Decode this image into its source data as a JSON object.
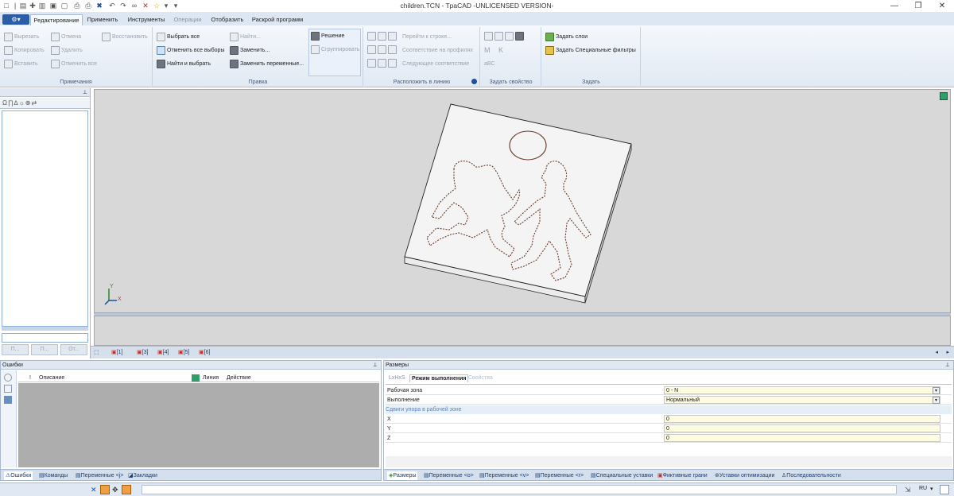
{
  "app": {
    "window_title": "children.TCN - TpaCAD -UNLICENSED VERSION-"
  },
  "window_controls": [
    "minimize-icon",
    "restore-icon",
    "close-icon"
  ],
  "menu_tabs": [
    {
      "label": "Редактирование",
      "active": true
    },
    {
      "label": "Применить",
      "active": false
    },
    {
      "label": "Инструменты",
      "active": false
    },
    {
      "label": "Операции",
      "active": false
    },
    {
      "label": "Отобразить",
      "active": false
    },
    {
      "label": "Раскрой программ",
      "active": false
    }
  ],
  "ribbon": {
    "notes": {
      "label": "Примечания",
      "items": [
        "Вырезать",
        "Копировать",
        "Вставить",
        "Отмена",
        "Удалить",
        "Отменить все",
        "Восстановить"
      ]
    },
    "edit": {
      "label": "Правка",
      "items": [
        "Выбрать все",
        "Отменить все выборы",
        "Найти и выбрать",
        "Найти...",
        "Заменить...",
        "Заменить переменные..."
      ],
      "big": "Решение",
      "group": "Сгруппировать"
    },
    "align": {
      "label": "Расположить в линию",
      "items": [
        "Перейти к строке...",
        "Соответствие на профилях",
        "Следующее соответствие"
      ]
    },
    "property": {
      "label": "Задать свойство",
      "glyphs": [
        "M",
        "K",
        "aBC"
      ]
    },
    "set": {
      "label": "Задать",
      "items": [
        "Задать слои",
        "Задать Специальные фильтры"
      ]
    }
  },
  "left_panel": {
    "footer_buttons": [
      "П...",
      "П...",
      "От..."
    ]
  },
  "view_tabs": [
    "[1]",
    "[3]",
    "[4]",
    "[5]",
    "[6]"
  ],
  "axes": {
    "y": "Y",
    "x": "X"
  },
  "errors_panel": {
    "title": "Ошибки",
    "columns": [
      "!",
      "Описание",
      "Линия",
      "Действие"
    ],
    "tabs": [
      "Ошибки",
      "Команды",
      "Переменные <j>",
      "Закладки"
    ]
  },
  "sizes_panel": {
    "title": "Размеры",
    "subtabs": [
      "LxHxS",
      "Режим выполнения",
      "Свойства"
    ],
    "rows": [
      {
        "label": "Рабочая зона",
        "value": "0 - N",
        "dropdown": true
      },
      {
        "label": "Выполнение",
        "value": "Нормальный",
        "dropdown": true
      }
    ],
    "section": "Сдвиги упора в рабочей зоне",
    "coords": [
      {
        "label": "X",
        "value": "0"
      },
      {
        "label": "Y",
        "value": "0"
      },
      {
        "label": "Z",
        "value": "0"
      }
    ],
    "tabs": [
      "Размеры",
      "Переменные <o>",
      "Переменные <v>",
      "Переменные <r>",
      "Специальные уставки",
      "Фиктивные грани",
      "Уставки оптимизации",
      "Последовательности"
    ]
  },
  "status": {
    "language": "RU"
  },
  "colors": {
    "accent": "#2c5ea8",
    "viewport_bg": "#d8d8d8",
    "panel_bg": "#fdfbe0"
  }
}
